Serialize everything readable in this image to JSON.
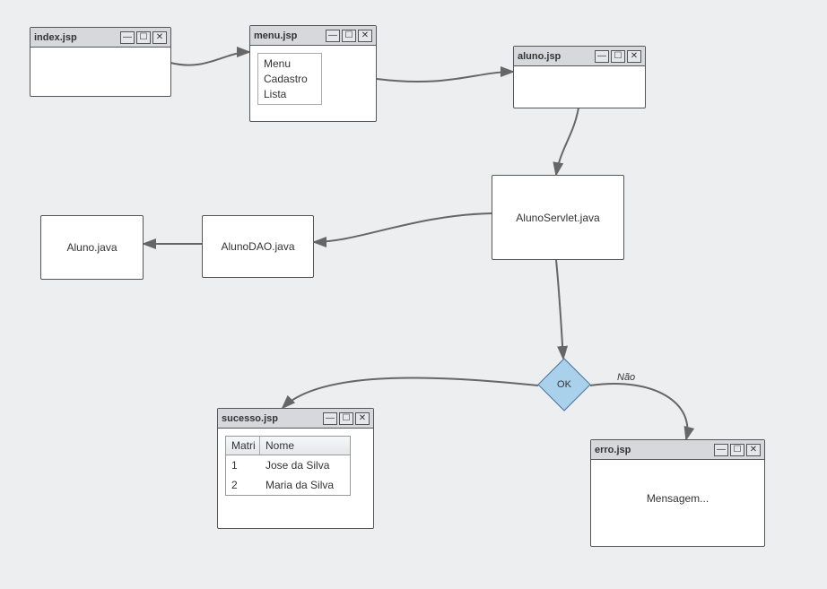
{
  "windows": {
    "index": {
      "title": "index.jsp"
    },
    "menu": {
      "title": "menu.jsp",
      "items": [
        "Menu",
        "Cadastro",
        "Lista"
      ]
    },
    "aluno_jsp": {
      "title": "aluno.jsp"
    },
    "sucesso": {
      "title": "sucesso.jsp",
      "table": {
        "headers": [
          "Matri",
          "Nome"
        ],
        "rows": [
          {
            "matri": "1",
            "nome": "Jose da Silva"
          },
          {
            "matri": "2",
            "nome": "Maria da Silva"
          }
        ]
      }
    },
    "erro": {
      "title": "erro.jsp",
      "message": "Mensagem..."
    }
  },
  "boxes": {
    "aluno_servlet": "AlunoServlet.java",
    "aluno_dao": "AlunoDAO.java",
    "aluno": "Aluno.java"
  },
  "decision": {
    "label": "OK",
    "no_label": "Não"
  }
}
